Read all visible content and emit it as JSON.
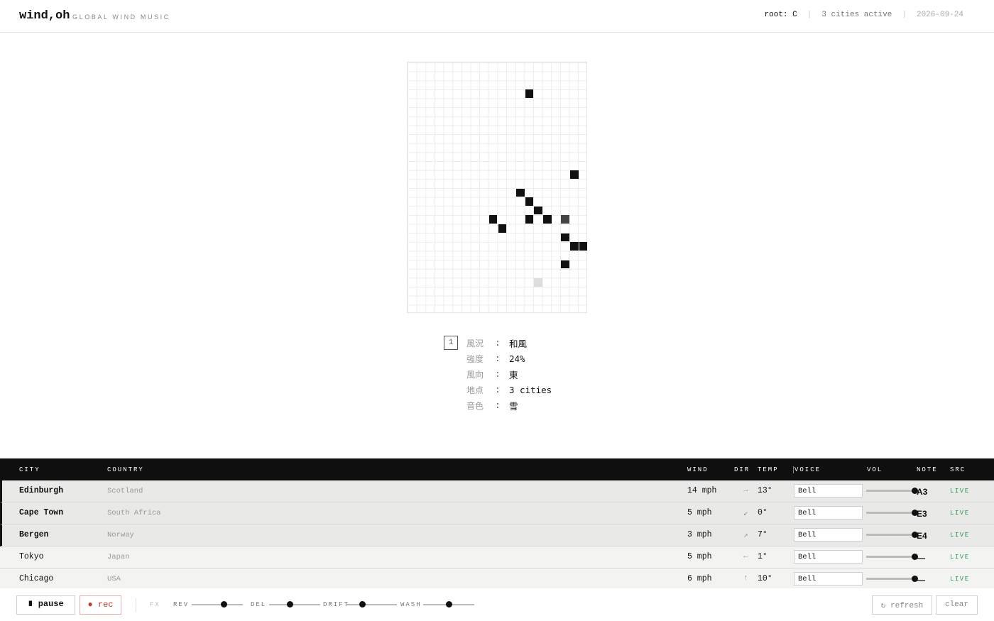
{
  "app": {
    "brand": "wind,oh",
    "tagline": "GLOBAL WIND MUSIC",
    "root": "root: C",
    "active": "3 cities active",
    "date": "2026-09-24"
  },
  "info": {
    "index": "1",
    "rows": [
      {
        "key": "風況",
        "colon": ":",
        "value": "和風"
      },
      {
        "key": "強度",
        "colon": ":",
        "value": "24%"
      },
      {
        "key": "風向",
        "colon": ":",
        "value": "東"
      },
      {
        "key": "地点",
        "colon": ":",
        "value": "3 cities"
      },
      {
        "key": "音色",
        "colon": ":",
        "value": "雪"
      }
    ]
  },
  "table": {
    "headers": {
      "city": "CITY",
      "country": "COUNTRY",
      "wind": "WIND",
      "dir": "DIR",
      "temp": "TEMP",
      "voice": "VOICE",
      "vol": "VOL",
      "note": "NOTE",
      "src": "SRC"
    },
    "rows": [
      {
        "city": "Edinburgh",
        "country": "Scotland",
        "wind": "14 mph",
        "dir": "→",
        "temp": "13°",
        "voice": "Bell",
        "vol": 1.0,
        "note": "A3",
        "src": "LIVE",
        "active": true
      },
      {
        "city": "Cape Town",
        "country": "South Africa",
        "wind": "5 mph",
        "dir": "↙",
        "temp": "0°",
        "voice": "Bell",
        "vol": 1.0,
        "note": "E3",
        "src": "LIVE",
        "active": true
      },
      {
        "city": "Bergen",
        "country": "Norway",
        "wind": "3 mph",
        "dir": "↗",
        "temp": "7°",
        "voice": "Bell",
        "vol": 1.0,
        "note": "E4",
        "src": "LIVE",
        "active": true
      },
      {
        "city": "Tokyo",
        "country": "Japan",
        "wind": "5 mph",
        "dir": "←",
        "temp": "1°",
        "voice": "Bell",
        "vol": 1.0,
        "note": "—",
        "src": "LIVE",
        "active": false
      },
      {
        "city": "Chicago",
        "country": "USA",
        "wind": "6 mph",
        "dir": "↑",
        "temp": "10°",
        "voice": "Bell",
        "vol": 1.0,
        "note": "—",
        "src": "LIVE",
        "active": false
      }
    ]
  },
  "footer": {
    "pause": "∎ pause",
    "rec": "● rec",
    "fx": "FX",
    "rev": "REV",
    "del": "DEL",
    "drift": "DRIFT",
    "wash": "WASH",
    "rev_value": 0.62,
    "del_value": 0.4,
    "drift_value": 0.32,
    "wash_value": 0.5,
    "refresh": "↻ refresh",
    "clear": "clear"
  },
  "grid": {
    "cols": 20,
    "rows": 28,
    "cells": [
      {
        "c": 13,
        "r": 3,
        "shade": "dark"
      },
      {
        "c": 18,
        "r": 12,
        "shade": "dark"
      },
      {
        "c": 12,
        "r": 14,
        "shade": "dark"
      },
      {
        "c": 13,
        "r": 15,
        "shade": "dark"
      },
      {
        "c": 14,
        "r": 16,
        "shade": "dark"
      },
      {
        "c": 9,
        "r": 17,
        "shade": "dark"
      },
      {
        "c": 13,
        "r": 17,
        "shade": "dark"
      },
      {
        "c": 15,
        "r": 17,
        "shade": "dark"
      },
      {
        "c": 17,
        "r": 17,
        "shade": "mid"
      },
      {
        "c": 10,
        "r": 18,
        "shade": "dark"
      },
      {
        "c": 17,
        "r": 19,
        "shade": "dark"
      },
      {
        "c": 18,
        "r": 20,
        "shade": "dark"
      },
      {
        "c": 19,
        "r": 20,
        "shade": "dark"
      },
      {
        "c": 17,
        "r": 22,
        "shade": "dark"
      },
      {
        "c": 14,
        "r": 24,
        "shade": "faint"
      }
    ]
  }
}
